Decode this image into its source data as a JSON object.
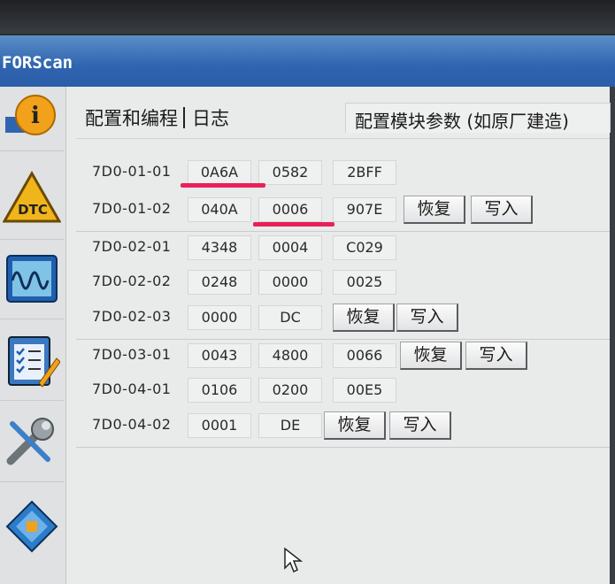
{
  "app": {
    "title": "FORScan"
  },
  "sidebar": {
    "items": [
      {
        "icon": "info-icon"
      },
      {
        "icon": "dtc-icon",
        "label": "DTC"
      },
      {
        "icon": "oscilloscope-icon"
      },
      {
        "icon": "checklist-icon"
      },
      {
        "icon": "wrench-icon"
      },
      {
        "icon": "chip-icon"
      }
    ]
  },
  "tabs": {
    "config_programming": "配置和编程",
    "log": "日志",
    "module_params": "配置模块参数 (如原厂建造)"
  },
  "buttons": {
    "restore": "恢复",
    "write": "写入"
  },
  "rows": [
    {
      "address": "7D0-01-01",
      "values": [
        "0A6A",
        "0582",
        "2BFF"
      ]
    },
    {
      "address": "7D0-01-02",
      "values": [
        "040A",
        "0006",
        "907E"
      ]
    },
    {
      "address": "7D0-02-01",
      "values": [
        "4348",
        "0004",
        "C029"
      ]
    },
    {
      "address": "7D0-02-02",
      "values": [
        "0248",
        "0000",
        "0025"
      ]
    },
    {
      "address": "7D0-02-03",
      "values": [
        "0000",
        "DC"
      ]
    },
    {
      "address": "7D0-03-01",
      "values": [
        "0043",
        "4800",
        "0066"
      ]
    },
    {
      "address": "7D0-04-01",
      "values": [
        "0106",
        "0200",
        "00E5"
      ]
    },
    {
      "address": "7D0-04-02",
      "values": [
        "0001",
        "DE"
      ]
    }
  ],
  "highlight_color": "#e8205a"
}
